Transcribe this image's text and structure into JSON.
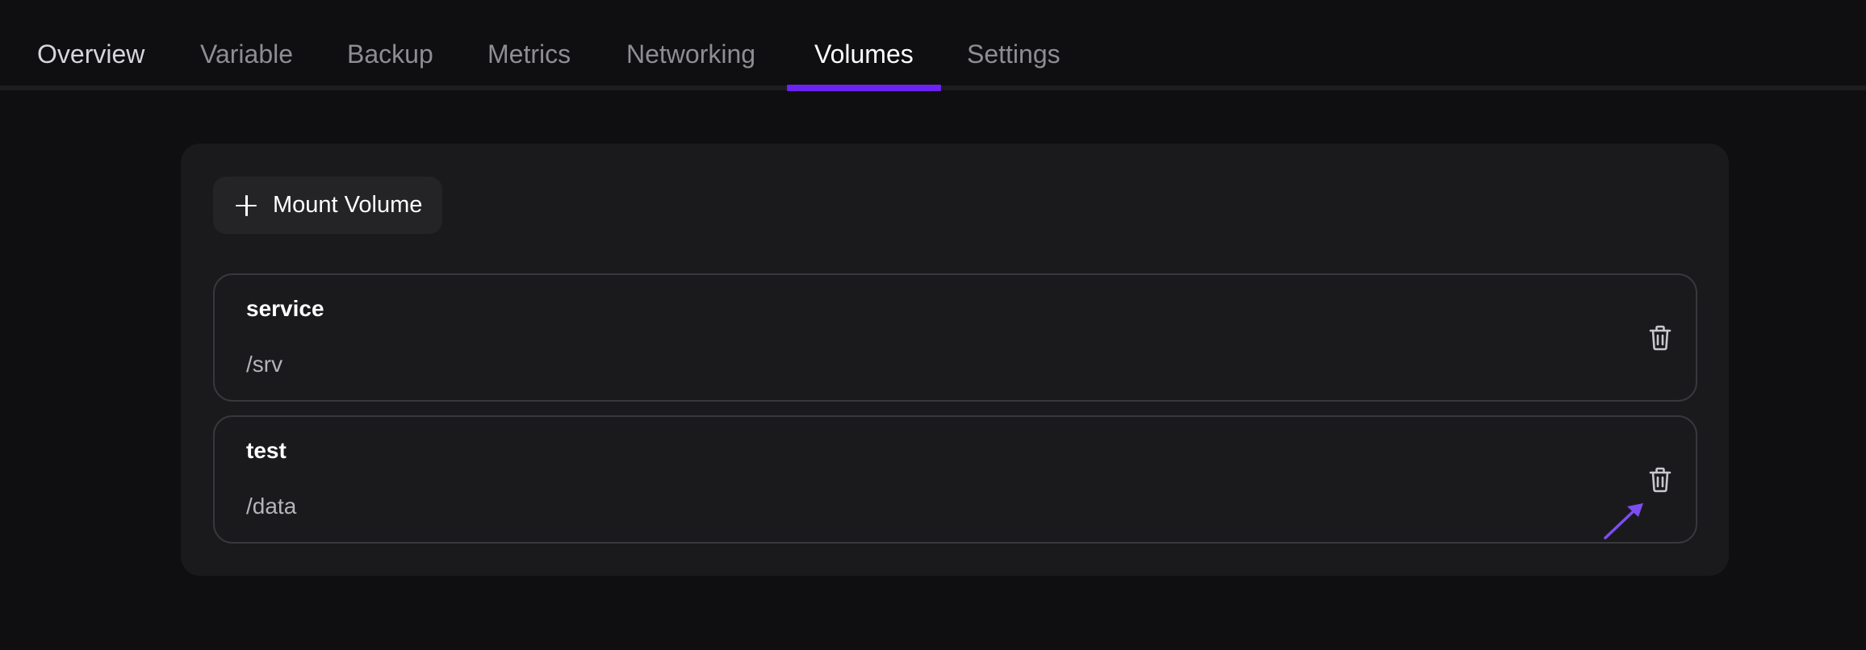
{
  "tabs": [
    {
      "label": "Overview"
    },
    {
      "label": "Variable"
    },
    {
      "label": "Backup"
    },
    {
      "label": "Metrics"
    },
    {
      "label": "Networking"
    },
    {
      "label": "Volumes"
    },
    {
      "label": "Settings"
    }
  ],
  "active_tab": "Volumes",
  "mount_button": {
    "label": "Mount Volume",
    "icon": "plus-icon"
  },
  "volumes": [
    {
      "name": "service",
      "path": "/srv",
      "action_icon": "trash-icon"
    },
    {
      "name": "test",
      "path": "/data",
      "action_icon": "trash-icon"
    }
  ],
  "colors": {
    "background": "#0f0f11",
    "panel": "#1a1a1d",
    "accent": "#6c22f2",
    "arrow": "#7c4ef0"
  }
}
